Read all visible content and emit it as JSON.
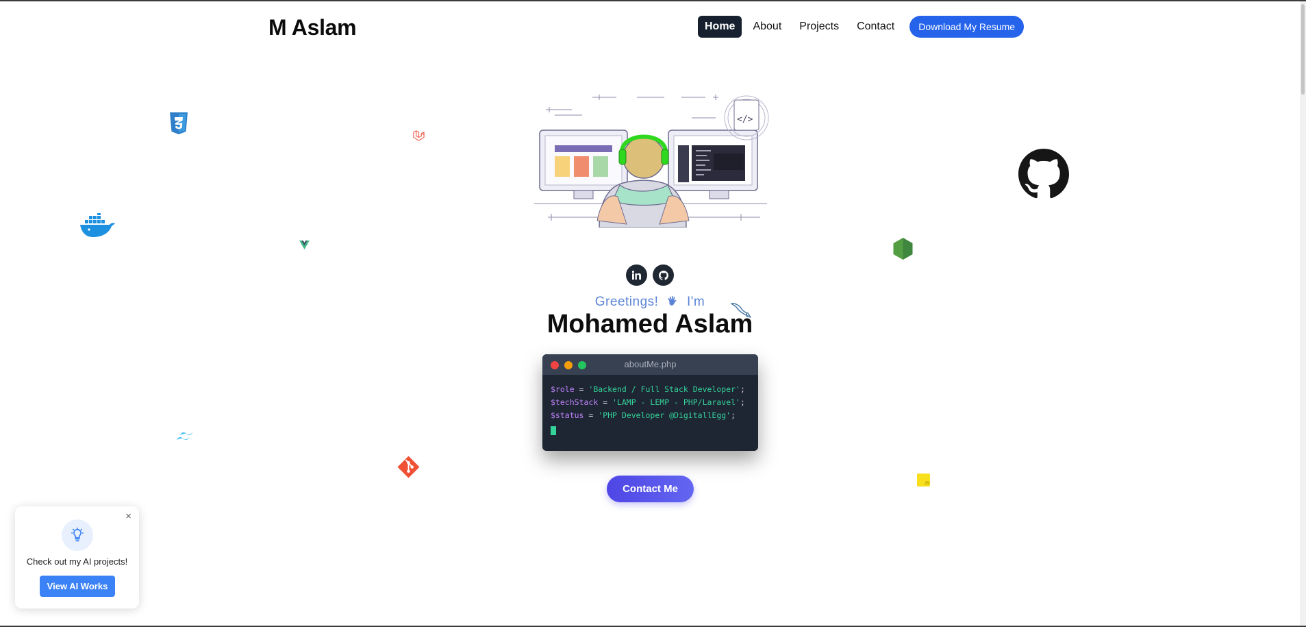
{
  "header": {
    "logo": "M Aslam",
    "nav": [
      {
        "label": "Home",
        "active": true
      },
      {
        "label": "About",
        "active": false
      },
      {
        "label": "Projects",
        "active": false
      },
      {
        "label": "Contact",
        "active": false
      }
    ],
    "resume_button": "Download My Resume"
  },
  "floating_icons": [
    "css3-icon",
    "laravel-icon",
    "docker-icon",
    "vue-icon",
    "github-icon",
    "nodejs-icon",
    "mysql-icon",
    "tailwind-icon",
    "git-icon",
    "javascript-icon"
  ],
  "hero": {
    "social_icons": [
      "linkedin-icon",
      "github-icon"
    ],
    "greeting": "Greetings!",
    "greeting_suffix": "I'm",
    "name": "Mohamed Aslam",
    "terminal": {
      "title": "aboutMe.php",
      "lines": [
        {
          "var": "$role",
          "value": "'Backend / Full Stack Developer'"
        },
        {
          "var": "$techStack",
          "value": "'LAMP - LEMP - PHP/Laravel'"
        },
        {
          "var": "$status",
          "value": "'PHP Developer @DigitallEgg'"
        }
      ]
    },
    "contact_button": "Contact Me"
  },
  "popup": {
    "close": "×",
    "icon": "lightbulb-icon",
    "text": "Check out my AI projects!",
    "button": "View AI Works"
  },
  "colors": {
    "nav_active_bg": "#17202f",
    "resume_btn": "#2563eb",
    "contact_btn": "#4f46e5",
    "greeting": "#5b84d6",
    "terminal_bg": "#1e2533",
    "terminal_var": "#c084fc",
    "terminal_string": "#34d399"
  }
}
